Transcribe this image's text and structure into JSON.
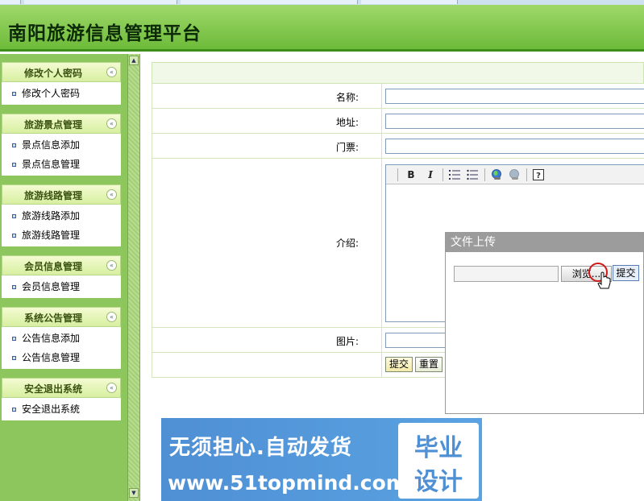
{
  "header": {
    "title": "南阳旅游信息管理平台"
  },
  "sidebar": {
    "groups": [
      {
        "title": "修改个人密码",
        "items": [
          "修改个人密码"
        ]
      },
      {
        "title": "旅游景点管理",
        "items": [
          "景点信息添加",
          "景点信息管理"
        ]
      },
      {
        "title": "旅游线路管理",
        "items": [
          "旅游线路添加",
          "旅游线路管理"
        ]
      },
      {
        "title": "会员信息管理",
        "items": [
          "会员信息管理"
        ]
      },
      {
        "title": "系统公告管理",
        "items": [
          "公告信息添加",
          "公告信息管理"
        ]
      },
      {
        "title": "安全退出系统",
        "items": [
          "安全退出系统"
        ]
      }
    ],
    "collapse_glyph": "«"
  },
  "form": {
    "fields": {
      "name_label": "名称:",
      "address_label": "地址:",
      "ticket_label": "门票:",
      "intro_label": "介绍:",
      "image_label": "图片:"
    },
    "editor_toolbar": {
      "bold": "B",
      "italic": "I"
    },
    "buttons": {
      "submit": "提交",
      "reset": "重置"
    }
  },
  "upload_dialog": {
    "title": "文件上传",
    "browse": "浏览...",
    "submit": "提交"
  },
  "watermark": {
    "slogan": "无须担心.自动发货",
    "site": "www.51topmind.com",
    "badge_line1": "毕业",
    "badge_line2": "设计"
  },
  "colors": {
    "header_green": "#6dbb3a",
    "sidebar_green": "#8cc65c",
    "dialog_gray": "#9c9c9c",
    "watermark_blue": "#4f8fd4"
  }
}
